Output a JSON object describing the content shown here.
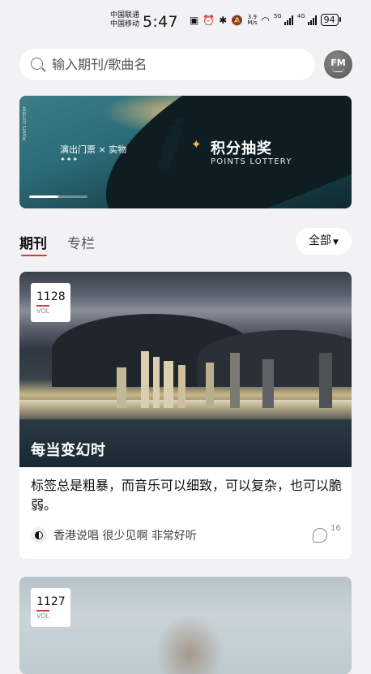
{
  "status_bar": {
    "carrier_1": "中国联通",
    "carrier_2": "中国移动",
    "time": "5:47",
    "net_speed_value": "3.9",
    "net_speed_unit": "M/s",
    "sig_1_tag": "5G",
    "sig_2_tag": "4G",
    "battery": "94"
  },
  "search": {
    "placeholder": "输入期刊/歌曲名"
  },
  "avatar": {
    "label": "FM"
  },
  "banner": {
    "left_text": "演出门票 × 实物",
    "diamonds": "✦✦✦",
    "side_text": "POINTS LOTTERY",
    "title": "积分抽奖",
    "subtitle": "POINTS LOTTERY",
    "progress": 0.5
  },
  "tabs": [
    {
      "label": "期刊",
      "active": true
    },
    {
      "label": "专栏",
      "active": false
    }
  ],
  "filter": {
    "label": "全部"
  },
  "cards": [
    {
      "vol": "1128",
      "vol_label": "VOL",
      "title": "每当变幻时",
      "description": "标签总是粗暴，而音乐可以细致，可以复杂，也可以脆弱。",
      "tags": "香港说唱 很少见啊 非常好听",
      "comments": "16"
    },
    {
      "vol": "1127",
      "vol_label": "VOL"
    }
  ],
  "colors": {
    "accent": "#d33a3a",
    "background": "#f2f2f5",
    "banner_highlight": "#f1c14b"
  }
}
